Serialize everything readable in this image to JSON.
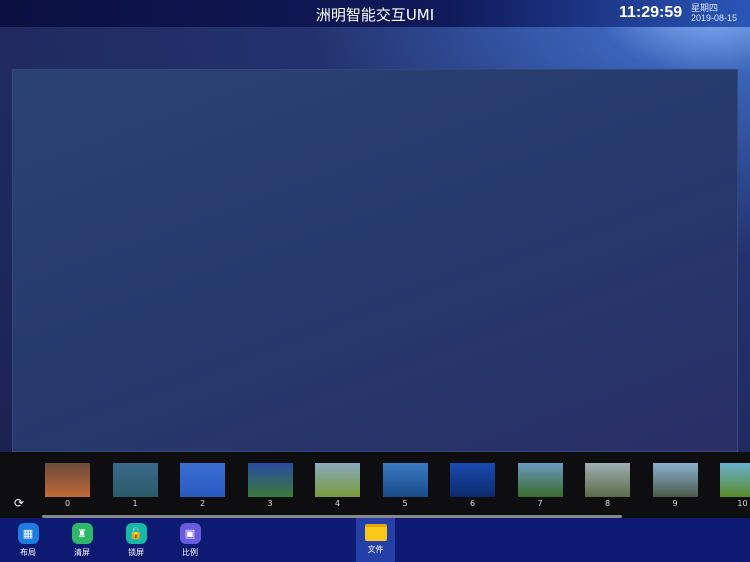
{
  "header": {
    "title": "洲明智能交互UMI",
    "time": "11:29:59",
    "weekday": "星期四",
    "date": "2019-08-15"
  },
  "thumbnails": [
    {
      "label": "0",
      "colors": [
        "#6a4a3a",
        "#c06a38"
      ]
    },
    {
      "label": "1",
      "colors": [
        "#3a6a8a",
        "#2a5a6a"
      ]
    },
    {
      "label": "2",
      "colors": [
        "#3a6ed0",
        "#2a5ac0"
      ]
    },
    {
      "label": "3",
      "colors": [
        "#2a4aa0",
        "#3a7a3a"
      ]
    },
    {
      "label": "4",
      "colors": [
        "#8aaac0",
        "#7a9a3a"
      ]
    },
    {
      "label": "5",
      "colors": [
        "#3a7ac0",
        "#1a4a8a"
      ]
    },
    {
      "label": "6",
      "colors": [
        "#1a4ab0",
        "#0a2a6a"
      ]
    },
    {
      "label": "7",
      "colors": [
        "#6a9ac0",
        "#3a6a2a"
      ]
    },
    {
      "label": "8",
      "colors": [
        "#a0b0b0",
        "#5a6a4a"
      ]
    },
    {
      "label": "9",
      "colors": [
        "#8ab0d0",
        "#4a5a4a"
      ]
    },
    {
      "label": "10",
      "colors": [
        "#6ab0d0",
        "#5a8a2a"
      ]
    }
  ],
  "toolbar": [
    {
      "label": "布局",
      "icon": "layout-icon",
      "color": "#1e7be0",
      "glyph": "▦"
    },
    {
      "label": "清屏",
      "icon": "broom-icon",
      "color": "#2fb86a",
      "glyph": "♜"
    },
    {
      "label": "锁屏",
      "icon": "unlock-icon",
      "color": "#18b8a8",
      "glyph": "🔓"
    },
    {
      "label": "比例",
      "icon": "ratio-icon",
      "color": "#6a5ae0",
      "glyph": "▣"
    }
  ],
  "file_button": {
    "label": "文件"
  }
}
